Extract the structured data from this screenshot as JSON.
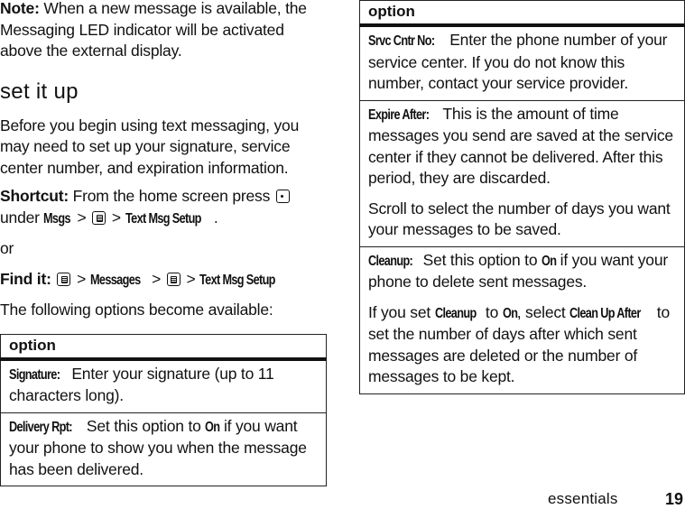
{
  "note": {
    "label": "Note:",
    "text": "When a new message is available, the Messaging LED indicator will be activated above the external display."
  },
  "section": {
    "heading": "set it up",
    "intro": "Before you begin using text messaging, you may need to set up your signature, service center number, and expiration information."
  },
  "shortcut": {
    "label": "Shortcut:",
    "text1": "From the home screen press",
    "key1_icon": "center-select-key-icon",
    "text2": "under",
    "item1": "Msgs",
    "sep": ">",
    "key2_icon": "menu-key-icon",
    "item2": "Text Msg Setup",
    "end": "."
  },
  "or_text": "or",
  "find_it": {
    "label": "Find it:",
    "key_icon": "menu-key-icon",
    "sep": ">",
    "item1": "Messages",
    "item2": "Text Msg Setup"
  },
  "options_intro": "The following options become available:",
  "left_table": {
    "header": "option",
    "rows": [
      {
        "term": "Signature:",
        "text": "Enter your signature (up to 11 characters long)."
      },
      {
        "term": "Delivery Rpt:",
        "pre": "Set this option to",
        "bold": "On",
        "post": "if you want your phone to show you when the message has been delivered."
      }
    ]
  },
  "right_table": {
    "header": "option",
    "rows": [
      {
        "term": "Srvc Cntr No:",
        "text": "Enter the phone number of your service center. If you do not know this number, contact your service provider."
      },
      {
        "term": "Expire After:",
        "text": "This is the amount of time messages you send are saved at the service center if they cannot be delivered. After this period, they are discarded.",
        "extra": "Scroll to select the number of days you want your messages to be saved."
      },
      {
        "term": "Cleanup:",
        "pre": "Set this option to",
        "bold": "On",
        "post": "if you want your phone to delete sent messages.",
        "extra_parts": {
          "p1": "If you set",
          "b1": "Cleanup",
          "p2": "to",
          "b2": "On",
          "p3": ", select",
          "b3": "Clean Up After",
          "p4": "to set the number of days after which sent messages are deleted or the number of messages to be kept."
        }
      }
    ]
  },
  "footer": {
    "section": "essentials",
    "page": "19"
  }
}
